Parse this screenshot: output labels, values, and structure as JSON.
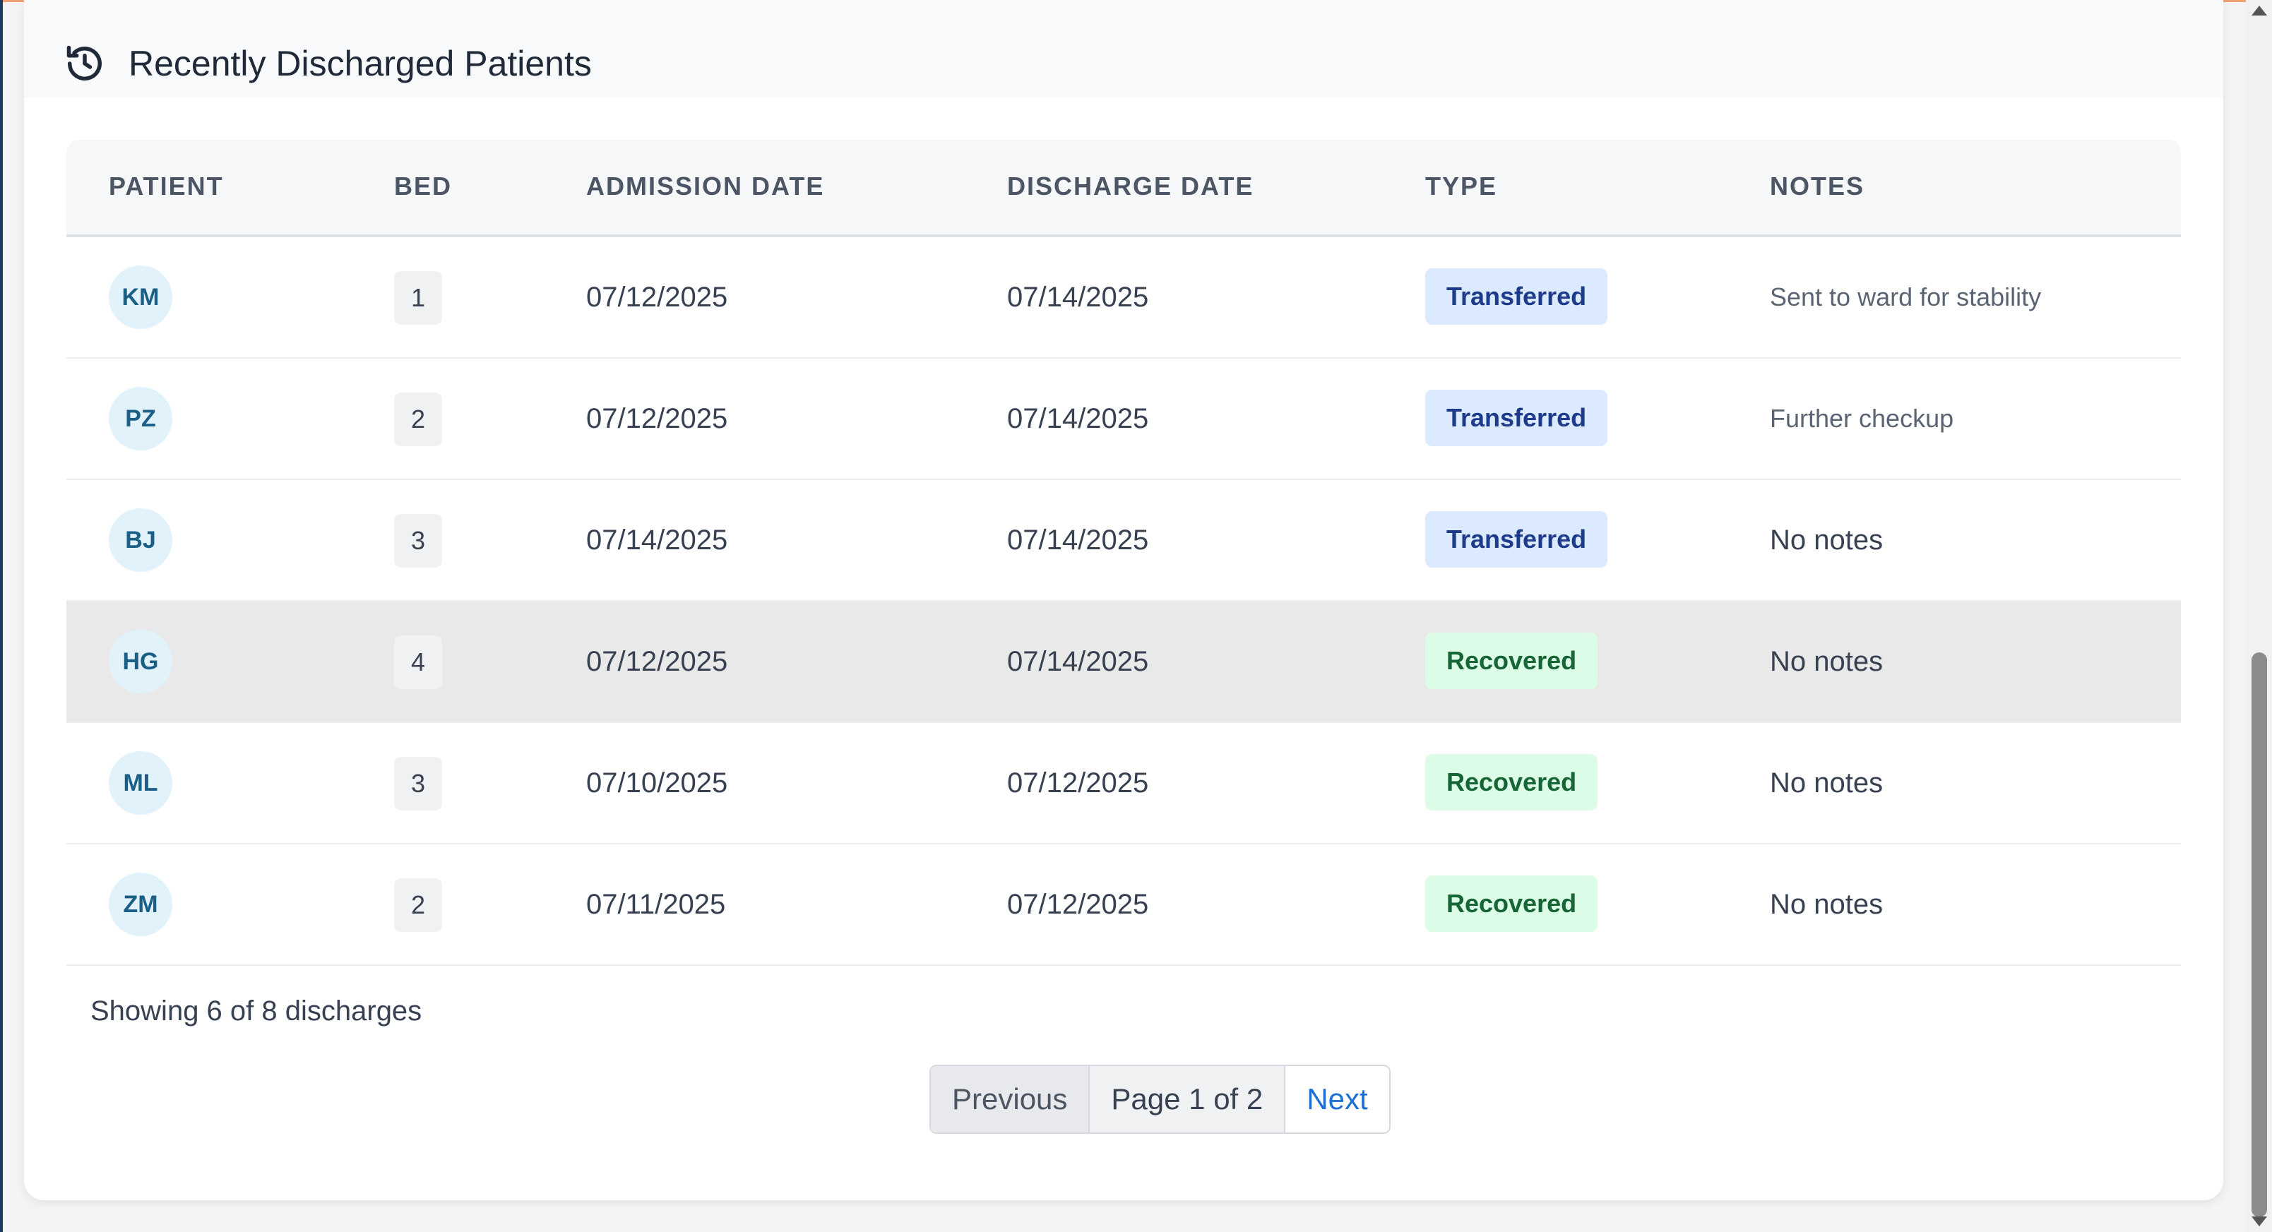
{
  "section": {
    "title": "Recently Discharged Patients",
    "icon": "history-icon"
  },
  "table": {
    "columns": [
      "PATIENT",
      "BED",
      "ADMISSION DATE",
      "DISCHARGE DATE",
      "TYPE",
      "NOTES"
    ],
    "rows": [
      {
        "initials": "KM",
        "bed": "1",
        "admission": "07/12/2025",
        "discharge": "07/14/2025",
        "type": "Transferred",
        "notes": "Sent to ward for stability"
      },
      {
        "initials": "PZ",
        "bed": "2",
        "admission": "07/12/2025",
        "discharge": "07/14/2025",
        "type": "Transferred",
        "notes": "Further checkup"
      },
      {
        "initials": "BJ",
        "bed": "3",
        "admission": "07/14/2025",
        "discharge": "07/14/2025",
        "type": "Transferred",
        "notes": "No notes"
      },
      {
        "initials": "HG",
        "bed": "4",
        "admission": "07/12/2025",
        "discharge": "07/14/2025",
        "type": "Recovered",
        "notes": "No notes"
      },
      {
        "initials": "ML",
        "bed": "3",
        "admission": "07/10/2025",
        "discharge": "07/12/2025",
        "type": "Recovered",
        "notes": "No notes"
      },
      {
        "initials": "ZM",
        "bed": "2",
        "admission": "07/11/2025",
        "discharge": "07/12/2025",
        "type": "Recovered",
        "notes": "No notes"
      }
    ]
  },
  "footer": {
    "showing": "Showing 6 of 8 discharges"
  },
  "pagination": {
    "previous": "Previous",
    "page_info": "Page 1 of 2",
    "next": "Next"
  },
  "colors": {
    "transferred_bg": "#dbeafe",
    "recovered_bg": "#dcfce7",
    "link": "#1d6fd6"
  }
}
